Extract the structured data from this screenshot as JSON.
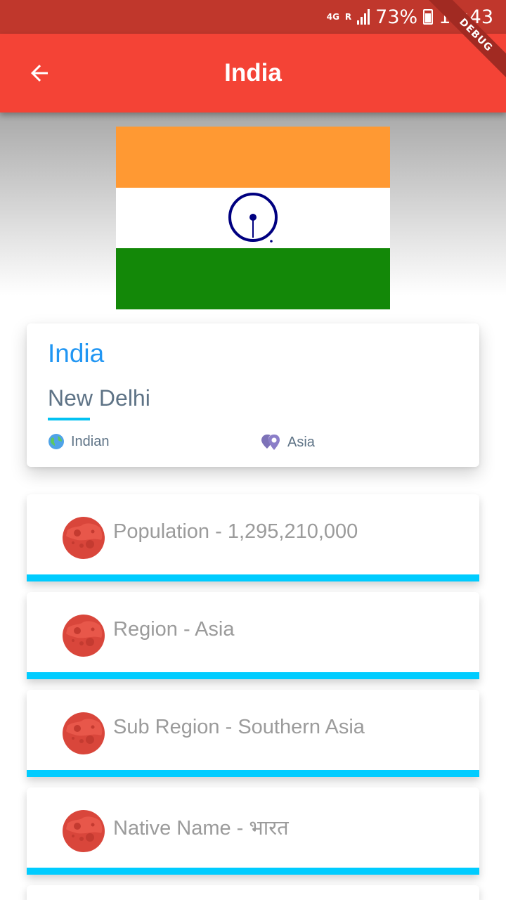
{
  "status_bar": {
    "network": "4G",
    "roaming": "R",
    "battery": "73%",
    "time": "17:43"
  },
  "debug_banner": "DEBUG",
  "app_bar": {
    "title": "India",
    "back_icon": "arrow-back-icon"
  },
  "flag": {
    "colors": [
      "#ff9933",
      "#ffffff",
      "#138808"
    ],
    "emblem_color": "#000080"
  },
  "info": {
    "name": "India",
    "capital": "New Delhi",
    "demonym": "Indian",
    "demonym_icon": "globe-icon",
    "region": "Asia",
    "region_icon": "location-pins-icon"
  },
  "stats": [
    {
      "label": "Population - 1,295,210,000",
      "icon": "planet-icon"
    },
    {
      "label": "Region - Asia",
      "icon": "planet-icon"
    },
    {
      "label": "Sub Region - Southern Asia",
      "icon": "planet-icon"
    },
    {
      "label": "Native Name - भारत",
      "icon": "planet-icon"
    }
  ],
  "colors": {
    "app_bar": "#f44336",
    "status_bar": "#c0372c",
    "accent_blue": "#2196f3",
    "accent_cyan": "#00ccff"
  }
}
